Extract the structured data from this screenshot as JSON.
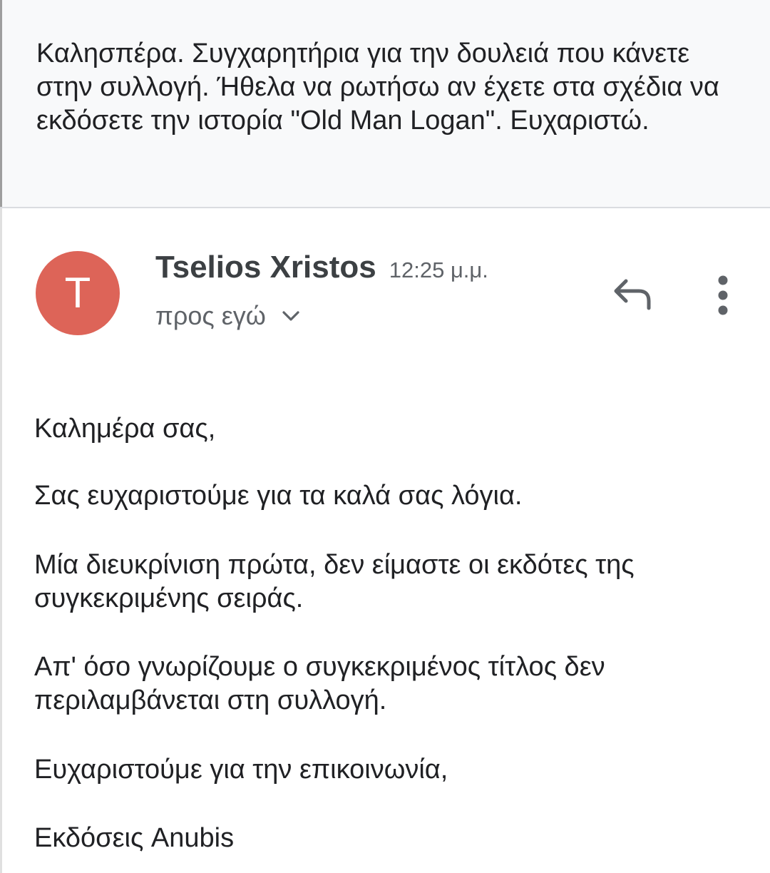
{
  "quoted_message": {
    "text": "Καλησπέρα. Συγχαρητήρια για την δουλειά που κάνετε στην συλλογή. Ήθελα να ρωτήσω αν έχετε στα σχέδια να εκδόσετε την ιστορία \"Old Man Logan\". Ευχαριστώ."
  },
  "message": {
    "sender_initial": "T",
    "sender_name": "Tselios Xristos",
    "time": "12:25 μ.μ.",
    "recipient": "προς εγώ",
    "avatar_color": "#dd6458",
    "icons": {
      "reply": "reply-icon",
      "more": "more-vert-icon",
      "expand": "chevron-down-icon"
    },
    "body": {
      "greeting": "Καλημέρα σας,",
      "thanks": "Σας ευχαριστούμε για τα καλά σας λόγια.",
      "clarification": "Μία διευκρίνιση πρώτα, δεν είμαστε οι εκδότες της συγκεκριμένης σειράς.",
      "info": "Απ' όσο γνωρίζουμε ο συγκεκριμένος τίτλος δεν περιλαμβάνεται στη συλλογή.",
      "closing": "Ευχαριστούμε για την επικοινωνία,",
      "signature": "Εκδόσεις Anubis"
    }
  }
}
